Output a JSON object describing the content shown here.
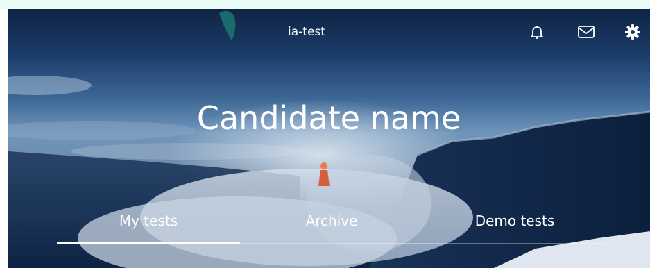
{
  "header": {
    "app_title": "ia-test",
    "icons": [
      "bell-icon",
      "mail-icon",
      "gear-icon"
    ]
  },
  "main": {
    "title": "Candidate name",
    "tabs": [
      {
        "label": "My tests",
        "active": true
      },
      {
        "label": "Archive",
        "active": false
      },
      {
        "label": "Demo tests",
        "active": false
      }
    ]
  },
  "colors": {
    "accent": "#ffffff",
    "background_top": "#0e2445",
    "strip": "#e9fbf4"
  }
}
